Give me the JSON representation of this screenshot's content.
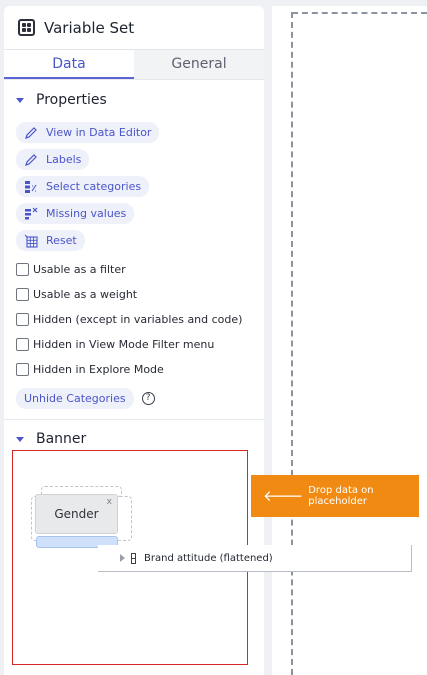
{
  "panel": {
    "title": "Variable Set",
    "tabs": [
      {
        "label": "Data",
        "active": true
      },
      {
        "label": "General",
        "active": false
      }
    ]
  },
  "properties": {
    "section_label": "Properties",
    "actions": [
      {
        "label": "View in Data Editor",
        "icon": "pencil-icon"
      },
      {
        "label": "Labels",
        "icon": "pencil-icon"
      },
      {
        "label": "Select categories",
        "icon": "category-filter-icon"
      },
      {
        "label": "Missing values",
        "icon": "missing-values-icon"
      },
      {
        "label": "Reset",
        "icon": "table-reset-icon"
      }
    ],
    "checkboxes": [
      {
        "label": "Usable as a filter",
        "checked": false
      },
      {
        "label": "Usable as a weight",
        "checked": false
      },
      {
        "label": "Hidden (except in variables and code)",
        "checked": false
      },
      {
        "label": "Hidden in View Mode Filter menu",
        "checked": false
      },
      {
        "label": "Hidden in Explore Mode",
        "checked": false
      }
    ],
    "unhide_label": "Unhide Categories",
    "help_glyph": "?"
  },
  "banner": {
    "section_label": "Banner",
    "card_label": "Gender",
    "card_close": "x"
  },
  "drop_hint": {
    "arrow": "🡐",
    "label": "Drop data on placeholder"
  },
  "drag_item": {
    "label": "Brand attitude (flattened)"
  },
  "colors": {
    "accent": "#4a55c8",
    "chip_bg": "#eef0fa",
    "drop_hint_bg": "#f08a12",
    "banner_outline": "#d72626"
  }
}
